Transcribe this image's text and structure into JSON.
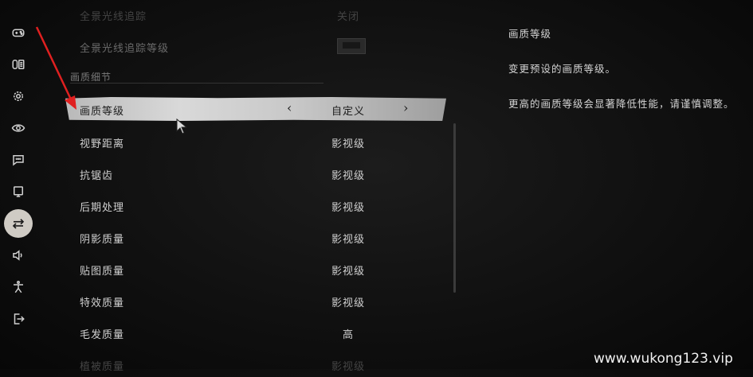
{
  "sidebar": {
    "items": [
      {
        "icon": "gamepad-icon"
      },
      {
        "icon": "keyboard-icon"
      },
      {
        "icon": "gear-icon"
      },
      {
        "icon": "eye-icon"
      },
      {
        "icon": "chat-icon"
      },
      {
        "icon": "monitor-icon"
      },
      {
        "icon": "sliders-icon",
        "active": true
      },
      {
        "icon": "speaker-icon"
      },
      {
        "icon": "accessibility-icon"
      },
      {
        "icon": "exit-icon"
      }
    ]
  },
  "main": {
    "top_rows": [
      {
        "label": "全景光线追踪",
        "value": "关闭"
      },
      {
        "label": "全景光线追踪等级",
        "value": ""
      }
    ],
    "section_title": "画质细节",
    "selected": {
      "label": "画质等级",
      "value": "自定义",
      "prev": "‹",
      "next": "›"
    },
    "rows": [
      {
        "label": "视野距离",
        "value": "影视级"
      },
      {
        "label": "抗锯齿",
        "value": "影视级"
      },
      {
        "label": "后期处理",
        "value": "影视级"
      },
      {
        "label": "阴影质量",
        "value": "影视级"
      },
      {
        "label": "贴图质量",
        "value": "影视级"
      },
      {
        "label": "特效质量",
        "value": "影视级"
      },
      {
        "label": "毛发质量",
        "value": "高"
      },
      {
        "label": "植被质量",
        "value": "影视级"
      }
    ]
  },
  "description": {
    "title": "画质等级",
    "line1": "变更预设的画质等级。",
    "line2": "更高的画质等级会显著降低性能，请谨慎调整。"
  },
  "watermark": "www.wukong123.vip",
  "colors": {
    "selected_bg": "#c8c8c8",
    "annotation_arrow": "#e02020"
  }
}
